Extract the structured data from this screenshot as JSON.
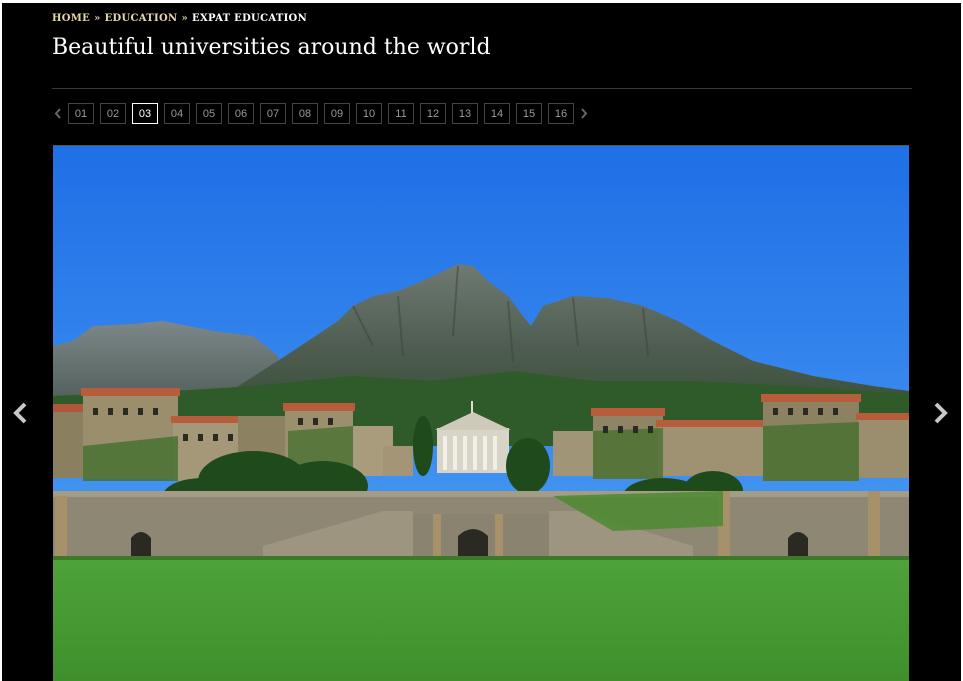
{
  "breadcrumb": {
    "items": [
      "Home",
      "Education"
    ],
    "separator": "»",
    "current": "Expat Education"
  },
  "page_title": "Beautiful universities around the world",
  "pagination": {
    "pages": [
      "01",
      "02",
      "03",
      "04",
      "05",
      "06",
      "07",
      "08",
      "09",
      "10",
      "11",
      "12",
      "13",
      "14",
      "15",
      "16"
    ],
    "current": "03",
    "prev_icon": "chevron-left-icon",
    "next_icon": "chevron-right-icon"
  },
  "photo": {
    "subject": "university-campus-photo"
  },
  "colors": {
    "background": "#000000",
    "breadcrumb_link": "#e6d9a8",
    "active_page_border": "#ffffff",
    "page_border": "#444444"
  }
}
